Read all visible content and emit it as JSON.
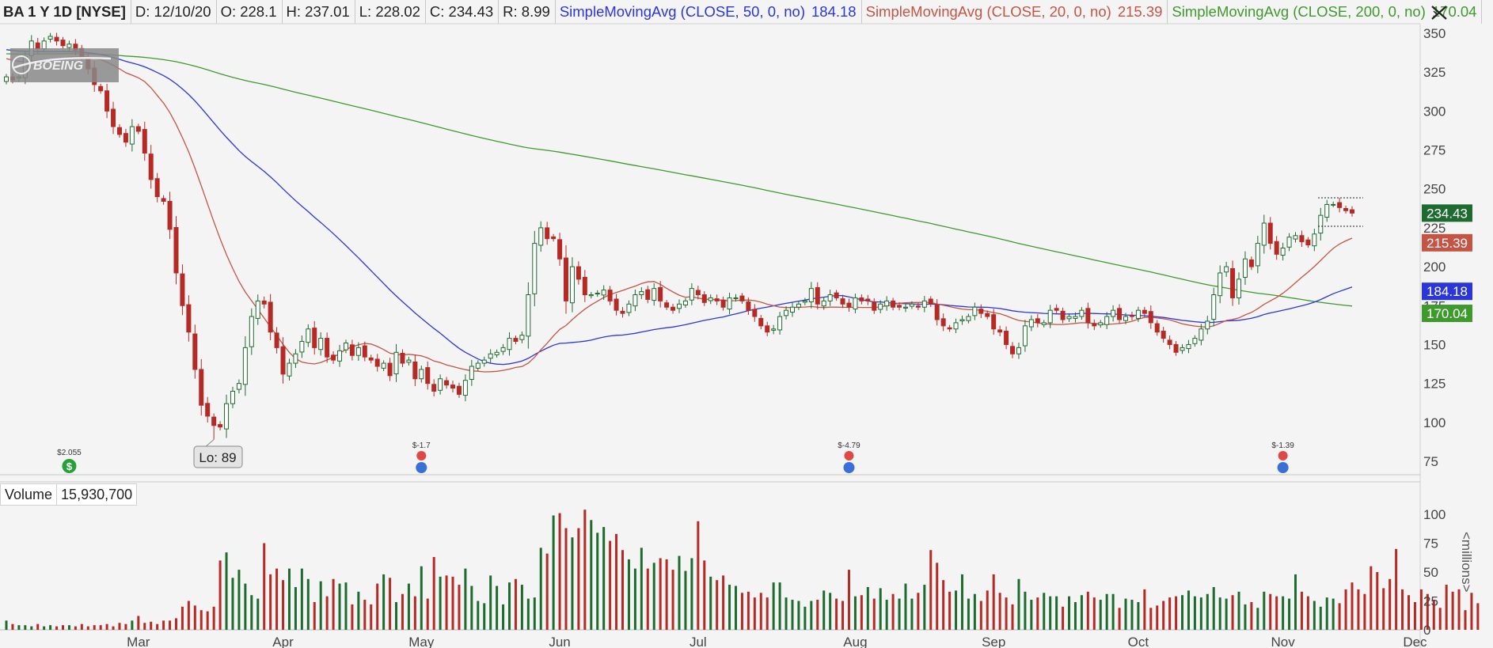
{
  "header": {
    "symbol": "BA 1 Y 1D [NYSE]",
    "date": "D: 12/10/20",
    "open": "O: 228.1",
    "high": "H: 237.01",
    "low": "L: 228.02",
    "close": "C: 234.43",
    "range": "R: 8.99",
    "sma50_label": "SimpleMovingAvg (CLOSE, 50, 0, no)",
    "sma50_value": "184.18",
    "sma20_label": "SimpleMovingAvg (CLOSE, 20, 0, no)",
    "sma20_value": "215.39",
    "sma200_label": "SimpleMovingAvg (CLOSE, 200, 0, no)",
    "sma200_value": "170.04"
  },
  "colors": {
    "up": "#1e6b2f",
    "down": "#b52a25",
    "sma50": "#2b36d9",
    "sma20": "#c45545",
    "sma200": "#3f9a2d",
    "last_price_bg": "#1e6b2f"
  },
  "icons": [
    "close-x-icon",
    "boeing-logo",
    "dividend-icon",
    "earnings-icon"
  ],
  "logo_text": "BOEING",
  "low_callout": "Lo: 89",
  "price_axis": {
    "ticks": [
      "350",
      "325",
      "300",
      "275",
      "250",
      "225",
      "200",
      "175",
      "150",
      "125",
      "100",
      "75"
    ],
    "last_price": "234.43",
    "sma20_tag": "215.39",
    "sma50_tag": "184.18",
    "sma200_tag": "170.04"
  },
  "events": [
    {
      "label": "$2.055",
      "type": "dividend",
      "index": 10
    },
    {
      "label": "$-1.7",
      "type": "earnings",
      "index": 66
    },
    {
      "label": "$-4.79",
      "type": "earnings",
      "index": 134
    },
    {
      "label": "$-1.39",
      "type": "earnings",
      "index": 203
    }
  ],
  "volume": {
    "label": "Volume",
    "value": "15,930,700",
    "unit": "<millions>",
    "ticks": [
      "100",
      "75",
      "50",
      "25",
      "0"
    ]
  },
  "chart_data": {
    "type": "candlestick",
    "title": "BA 1 Y 1D [NYSE]",
    "x_months": [
      "Mar",
      "Apr",
      "May",
      "Jun",
      "Jul",
      "Aug",
      "Sep",
      "Oct",
      "Nov",
      "Dec"
    ],
    "month_start_index": [
      21,
      44,
      66,
      88,
      110,
      135,
      157,
      180,
      203,
      224
    ],
    "ylim": [
      70,
      357
    ],
    "volume_ylim": [
      0,
      105
    ],
    "close": [
      322,
      320,
      322,
      335,
      345,
      340,
      345,
      348,
      345,
      342,
      343,
      339,
      335,
      327,
      317,
      313,
      300,
      290,
      285,
      280,
      290,
      287,
      273,
      256,
      245,
      242,
      224,
      196,
      175,
      158,
      134,
      111,
      104,
      98,
      97,
      112,
      120,
      125,
      148,
      168,
      178,
      176,
      158,
      148,
      131,
      138,
      144,
      152,
      160,
      148,
      154,
      142,
      140,
      146,
      151,
      143,
      148,
      142,
      140,
      136,
      138,
      130,
      145,
      138,
      140,
      128,
      134,
      125,
      120,
      128,
      124,
      122,
      118,
      127,
      136,
      138,
      140,
      144,
      145,
      148,
      154,
      152,
      156,
      182,
      215,
      225,
      218,
      218,
      205,
      178,
      200,
      192,
      182,
      182,
      183,
      185,
      178,
      172,
      170,
      176,
      182,
      184,
      179,
      186,
      178,
      174,
      172,
      176,
      178,
      186,
      182,
      177,
      180,
      178,
      174,
      180,
      180,
      178,
      172,
      168,
      162,
      158,
      160,
      168,
      172,
      174,
      176,
      178,
      186,
      176,
      178,
      182,
      180,
      176,
      174,
      180,
      178,
      178,
      172,
      176,
      178,
      174,
      174,
      174,
      176,
      174,
      178,
      176,
      166,
      162,
      160,
      164,
      166,
      168,
      174,
      170,
      168,
      160,
      158,
      150,
      144,
      148,
      162,
      166,
      164,
      164,
      172,
      172,
      166,
      168,
      168,
      172,
      164,
      162,
      164,
      168,
      172,
      166,
      168,
      168,
      172,
      170,
      164,
      158,
      154,
      150,
      145,
      148,
      150,
      154,
      160,
      165,
      182,
      196,
      200,
      180,
      192,
      205,
      200,
      215,
      228,
      215,
      208,
      212,
      219,
      220,
      216,
      214,
      221,
      233,
      240,
      240,
      238,
      236,
      234.43
    ],
    "volume": [
      8,
      5,
      4,
      4,
      3,
      5,
      3,
      4,
      3,
      4,
      4,
      3,
      5,
      3,
      4,
      4,
      5,
      3,
      6,
      5,
      8,
      12,
      6,
      7,
      5,
      8,
      8,
      10,
      20,
      25,
      21,
      17,
      16,
      20,
      60,
      67,
      45,
      52,
      40,
      30,
      27,
      75,
      48,
      53,
      43,
      53,
      37,
      53,
      44,
      24,
      42,
      29,
      44,
      40,
      41,
      22,
      33,
      26,
      22,
      40,
      48,
      45,
      24,
      31,
      40,
      29,
      55,
      27,
      63,
      46,
      47,
      46,
      39,
      53,
      38,
      25,
      23,
      47,
      38,
      22,
      41,
      44,
      39,
      27,
      28,
      71,
      66,
      99,
      101,
      88,
      80,
      88,
      104,
      95,
      84,
      89,
      77,
      83,
      69,
      61,
      53,
      71,
      53,
      58,
      62,
      61,
      52,
      64,
      51,
      62,
      94,
      60,
      46,
      43,
      47,
      39,
      38,
      32,
      33,
      28,
      32,
      28,
      41,
      41,
      28,
      26,
      25,
      20,
      25,
      26,
      34,
      32,
      27,
      25,
      52,
      29,
      30,
      37,
      27,
      36,
      26,
      31,
      27,
      40,
      27,
      32,
      39,
      69,
      58,
      43,
      33,
      34,
      48,
      27,
      31,
      25,
      34,
      48,
      32,
      28,
      22,
      44,
      33,
      26,
      28,
      32,
      29,
      29,
      20,
      29,
      24,
      30,
      33,
      28,
      26,
      31,
      31,
      19,
      27,
      26,
      24,
      35,
      19,
      21,
      25,
      28,
      29,
      30,
      34,
      29,
      28,
      31,
      37,
      28,
      27,
      30,
      33,
      22,
      24,
      19,
      33,
      31,
      29,
      29,
      27,
      48,
      33,
      29,
      25,
      20,
      28,
      27,
      23,
      35,
      41,
      35,
      31,
      55,
      50,
      36,
      44,
      70,
      35,
      30,
      24,
      35,
      31,
      26,
      19,
      39,
      33,
      35,
      17,
      32,
      23
    ],
    "sma50_end": 184.18,
    "sma20_end": 215.39,
    "sma200_end": 170.04,
    "low": 89
  }
}
